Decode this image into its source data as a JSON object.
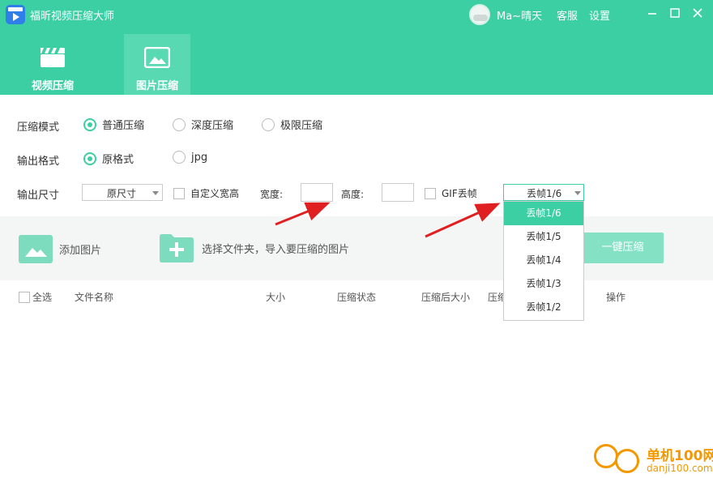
{
  "app": {
    "title": "福昕视频压缩大师"
  },
  "user": {
    "name": "Ma~晴天"
  },
  "header_links": {
    "service": "客服",
    "settings": "设置"
  },
  "tabs": [
    {
      "label": "视频压缩",
      "active": false
    },
    {
      "label": "图片压缩",
      "active": true
    }
  ],
  "compress_mode": {
    "label": "压缩模式",
    "options": [
      "普通压缩",
      "深度压缩",
      "极限压缩"
    ],
    "selected": "普通压缩"
  },
  "output_format": {
    "label": "输出格式",
    "options": [
      "原格式",
      "jpg"
    ],
    "selected": "原格式"
  },
  "output_size": {
    "label": "输出尺寸",
    "select_value": "原尺寸",
    "custom_checkbox": "自定义宽高",
    "width_label": "宽度:",
    "height_label": "高度:",
    "width_value": "",
    "height_value": ""
  },
  "gif": {
    "checkbox_label": "GIF丢帧",
    "select_value": "丢帧1/6",
    "options": [
      "丢帧1/6",
      "丢帧1/5",
      "丢帧1/4",
      "丢帧1/3",
      "丢帧1/2"
    ],
    "selected_option": "丢帧1/6"
  },
  "toolbar": {
    "add_image": "添加图片",
    "select_folder": "选择文件夹，导入要压缩的图片",
    "compress_all": "一键压缩"
  },
  "table": {
    "select_all": "全选",
    "columns": [
      "文件名称",
      "大小",
      "压缩状态",
      "压缩后大小",
      "压缩",
      "操作"
    ]
  },
  "watermark": {
    "title": "单机100网",
    "url": "danji100.com"
  },
  "colors": {
    "accent": "#3ccfa3",
    "tab_active": "#58d9b2",
    "button_light": "#84e1c4",
    "arrow": "#e02020",
    "watermark": "#f39800"
  }
}
